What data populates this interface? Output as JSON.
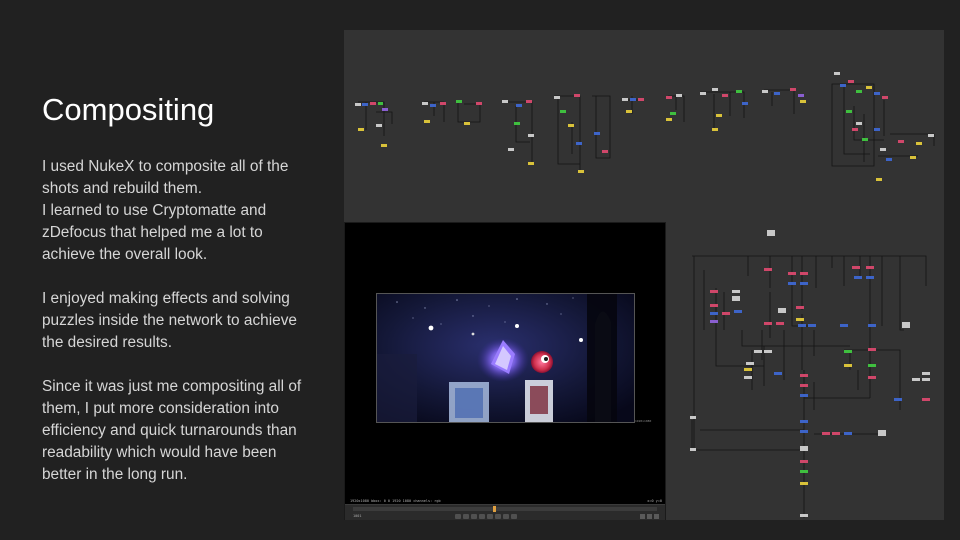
{
  "slide": {
    "title": "Compositing",
    "paragraph_1": [
      "I used NukeX to composite all of the",
      "shots and rebuild them.",
      "I learned to use Cryptomatte and",
      "zDefocus that helped me a lot to",
      "achieve the overall look."
    ],
    "paragraph_2": [
      "I enjoyed making effects and solving",
      "puzzles inside the network to achieve",
      "the desired results."
    ],
    "paragraph_3": [
      "Since it was just me compositing all of",
      "them, I put more consideration into",
      "efficiency and quick turnarounds than",
      "readability which would have been",
      "better in the long run."
    ]
  },
  "viewer": {
    "frame_label": "1920x1080",
    "info_left": "1920x1080  bbox: 0 0 1920 1080  channels: rgb",
    "info_right": "x=0 y=0",
    "current_frame": "1001"
  },
  "colors": {
    "slide_bg": "#212121",
    "graph_bg": "#333333",
    "node_pink": "#d0476a",
    "node_blue": "#3d64c8",
    "node_green": "#3fbf3f",
    "node_yellow": "#d9c23a",
    "node_grey": "#c8c8c8",
    "node_purple": "#8a5fd0",
    "timeline_head": "#e0a040"
  }
}
